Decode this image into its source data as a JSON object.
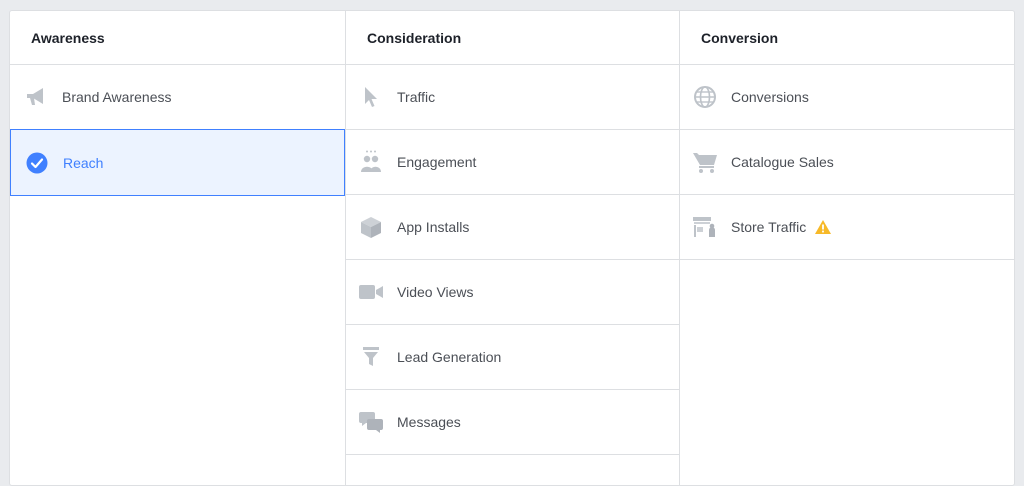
{
  "columns": [
    {
      "title": "Awareness",
      "items": [
        {
          "label": "Brand Awareness",
          "icon": "megaphone-icon"
        },
        {
          "label": "Reach",
          "icon": "check-circle-icon",
          "selected": true
        }
      ]
    },
    {
      "title": "Consideration",
      "items": [
        {
          "label": "Traffic",
          "icon": "cursor-icon"
        },
        {
          "label": "Engagement",
          "icon": "people-icon"
        },
        {
          "label": "App Installs",
          "icon": "box-icon"
        },
        {
          "label": "Video Views",
          "icon": "video-camera-icon"
        },
        {
          "label": "Lead Generation",
          "icon": "funnel-icon"
        },
        {
          "label": "Messages",
          "icon": "chat-bubbles-icon"
        }
      ]
    },
    {
      "title": "Conversion",
      "items": [
        {
          "label": "Conversions",
          "icon": "globe-icon"
        },
        {
          "label": "Catalogue Sales",
          "icon": "shopping-cart-icon"
        },
        {
          "label": "Store Traffic",
          "icon": "store-icon",
          "warning": "warning-icon"
        }
      ]
    }
  ],
  "colors": {
    "background": "#e9ebee",
    "panel": "#ffffff",
    "border": "#dddfe2",
    "icon": "#bec3c9",
    "selected_bg": "#ecf3ff",
    "selected_accent": "#4080ff",
    "warning": "#f7b928"
  }
}
